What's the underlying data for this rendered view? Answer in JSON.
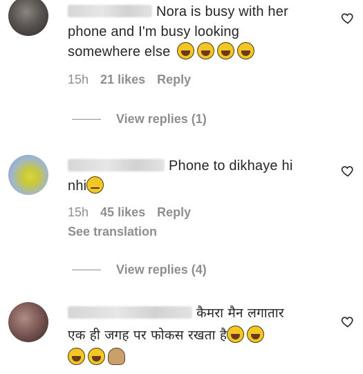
{
  "comments": [
    {
      "username": "",
      "text_lines": [
        "Nora is busy with her",
        "phone and I'm busy looking",
        "somewhere else"
      ],
      "emojis": [
        "tears-of-joy",
        "tears-of-joy",
        "tears-of-joy",
        "tears-of-joy"
      ],
      "time": "15h",
      "likes": "21 likes",
      "reply": "Reply",
      "view_replies": "View replies (1)"
    },
    {
      "username": "",
      "text_lines": [
        "Phone to dikhaye hi",
        "nhi"
      ],
      "emojis": [
        "unamused-face"
      ],
      "time": "15h",
      "likes": "45 likes",
      "reply": "Reply",
      "see_translation": "See translation",
      "view_replies": "View replies (4)"
    },
    {
      "username": "",
      "text_lines": [
        "कैमरा मैन लगातार",
        "एक ही जगह पर फोकस रखता है"
      ],
      "emojis": [
        "tears-of-joy",
        "tears-of-joy",
        "tears-of-joy",
        "tears-of-joy",
        "person-facepalming"
      ],
      "time": "",
      "likes": "",
      "reply": ""
    }
  ],
  "icons": {
    "like": "heart-outline-icon"
  },
  "colors": {
    "text": "#262626",
    "secondary": "#8e8e8e",
    "background": "#ffffff"
  }
}
